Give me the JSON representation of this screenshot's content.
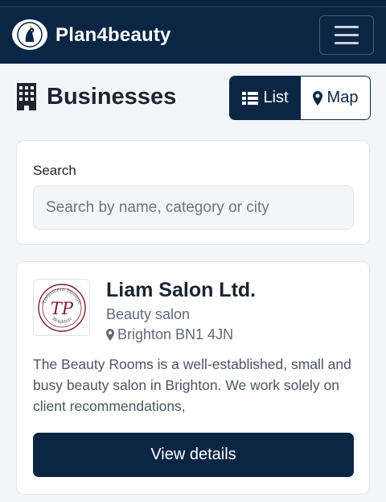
{
  "navbar": {
    "brand": "Plan4beauty",
    "logo_icon": "horse-head-logo-icon",
    "menu_icon": "hamburger-menu-icon",
    "background": "#0b2545"
  },
  "page": {
    "title": "Businesses",
    "title_icon": "building-icon",
    "view_toggle": {
      "list_label": "List",
      "list_icon": "list-icon",
      "map_label": "Map",
      "map_icon": "map-marker-icon",
      "active": "List"
    }
  },
  "search": {
    "label": "Search",
    "placeholder": "Search by name, category or city",
    "value": ""
  },
  "businesses": [
    {
      "name": "Liam Salon Ltd.",
      "category": "Beauty salon",
      "location": "Brighton BN1 4JN",
      "location_icon": "map-marker-icon",
      "description": "The Beauty Rooms is a well-established, small and busy beauty salon in Brighton. We work solely on client recommendations,",
      "button_label": "View details",
      "logo": {
        "monogram": "TP",
        "arc_top": "Treatment Lounge",
        "arc_bottom": "Brighton"
      }
    }
  ],
  "colors": {
    "primary": "#0b2545",
    "page_bg": "#f3f6f9",
    "muted_text": "#5f6b78"
  }
}
